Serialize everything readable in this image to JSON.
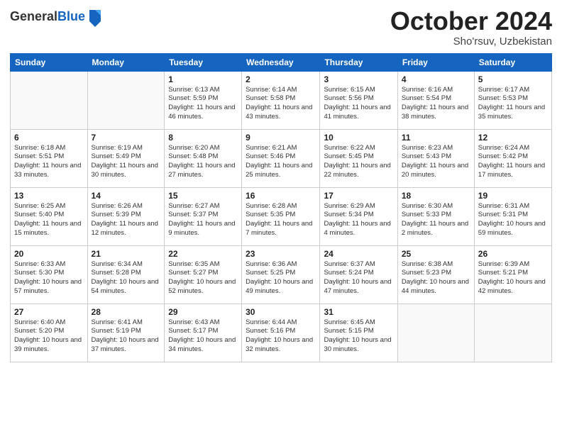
{
  "header": {
    "logo_general": "General",
    "logo_blue": "Blue",
    "month_title": "October 2024",
    "location": "Sho'rsuv, Uzbekistan"
  },
  "days_of_week": [
    "Sunday",
    "Monday",
    "Tuesday",
    "Wednesday",
    "Thursday",
    "Friday",
    "Saturday"
  ],
  "weeks": [
    [
      {
        "day": "",
        "sunrise": "",
        "sunset": "",
        "daylight": ""
      },
      {
        "day": "",
        "sunrise": "",
        "sunset": "",
        "daylight": ""
      },
      {
        "day": "1",
        "sunrise": "Sunrise: 6:13 AM",
        "sunset": "Sunset: 5:59 PM",
        "daylight": "Daylight: 11 hours and 46 minutes."
      },
      {
        "day": "2",
        "sunrise": "Sunrise: 6:14 AM",
        "sunset": "Sunset: 5:58 PM",
        "daylight": "Daylight: 11 hours and 43 minutes."
      },
      {
        "day": "3",
        "sunrise": "Sunrise: 6:15 AM",
        "sunset": "Sunset: 5:56 PM",
        "daylight": "Daylight: 11 hours and 41 minutes."
      },
      {
        "day": "4",
        "sunrise": "Sunrise: 6:16 AM",
        "sunset": "Sunset: 5:54 PM",
        "daylight": "Daylight: 11 hours and 38 minutes."
      },
      {
        "day": "5",
        "sunrise": "Sunrise: 6:17 AM",
        "sunset": "Sunset: 5:53 PM",
        "daylight": "Daylight: 11 hours and 35 minutes."
      }
    ],
    [
      {
        "day": "6",
        "sunrise": "Sunrise: 6:18 AM",
        "sunset": "Sunset: 5:51 PM",
        "daylight": "Daylight: 11 hours and 33 minutes."
      },
      {
        "day": "7",
        "sunrise": "Sunrise: 6:19 AM",
        "sunset": "Sunset: 5:49 PM",
        "daylight": "Daylight: 11 hours and 30 minutes."
      },
      {
        "day": "8",
        "sunrise": "Sunrise: 6:20 AM",
        "sunset": "Sunset: 5:48 PM",
        "daylight": "Daylight: 11 hours and 27 minutes."
      },
      {
        "day": "9",
        "sunrise": "Sunrise: 6:21 AM",
        "sunset": "Sunset: 5:46 PM",
        "daylight": "Daylight: 11 hours and 25 minutes."
      },
      {
        "day": "10",
        "sunrise": "Sunrise: 6:22 AM",
        "sunset": "Sunset: 5:45 PM",
        "daylight": "Daylight: 11 hours and 22 minutes."
      },
      {
        "day": "11",
        "sunrise": "Sunrise: 6:23 AM",
        "sunset": "Sunset: 5:43 PM",
        "daylight": "Daylight: 11 hours and 20 minutes."
      },
      {
        "day": "12",
        "sunrise": "Sunrise: 6:24 AM",
        "sunset": "Sunset: 5:42 PM",
        "daylight": "Daylight: 11 hours and 17 minutes."
      }
    ],
    [
      {
        "day": "13",
        "sunrise": "Sunrise: 6:25 AM",
        "sunset": "Sunset: 5:40 PM",
        "daylight": "Daylight: 11 hours and 15 minutes."
      },
      {
        "day": "14",
        "sunrise": "Sunrise: 6:26 AM",
        "sunset": "Sunset: 5:39 PM",
        "daylight": "Daylight: 11 hours and 12 minutes."
      },
      {
        "day": "15",
        "sunrise": "Sunrise: 6:27 AM",
        "sunset": "Sunset: 5:37 PM",
        "daylight": "Daylight: 11 hours and 9 minutes."
      },
      {
        "day": "16",
        "sunrise": "Sunrise: 6:28 AM",
        "sunset": "Sunset: 5:35 PM",
        "daylight": "Daylight: 11 hours and 7 minutes."
      },
      {
        "day": "17",
        "sunrise": "Sunrise: 6:29 AM",
        "sunset": "Sunset: 5:34 PM",
        "daylight": "Daylight: 11 hours and 4 minutes."
      },
      {
        "day": "18",
        "sunrise": "Sunrise: 6:30 AM",
        "sunset": "Sunset: 5:33 PM",
        "daylight": "Daylight: 11 hours and 2 minutes."
      },
      {
        "day": "19",
        "sunrise": "Sunrise: 6:31 AM",
        "sunset": "Sunset: 5:31 PM",
        "daylight": "Daylight: 10 hours and 59 minutes."
      }
    ],
    [
      {
        "day": "20",
        "sunrise": "Sunrise: 6:33 AM",
        "sunset": "Sunset: 5:30 PM",
        "daylight": "Daylight: 10 hours and 57 minutes."
      },
      {
        "day": "21",
        "sunrise": "Sunrise: 6:34 AM",
        "sunset": "Sunset: 5:28 PM",
        "daylight": "Daylight: 10 hours and 54 minutes."
      },
      {
        "day": "22",
        "sunrise": "Sunrise: 6:35 AM",
        "sunset": "Sunset: 5:27 PM",
        "daylight": "Daylight: 10 hours and 52 minutes."
      },
      {
        "day": "23",
        "sunrise": "Sunrise: 6:36 AM",
        "sunset": "Sunset: 5:25 PM",
        "daylight": "Daylight: 10 hours and 49 minutes."
      },
      {
        "day": "24",
        "sunrise": "Sunrise: 6:37 AM",
        "sunset": "Sunset: 5:24 PM",
        "daylight": "Daylight: 10 hours and 47 minutes."
      },
      {
        "day": "25",
        "sunrise": "Sunrise: 6:38 AM",
        "sunset": "Sunset: 5:23 PM",
        "daylight": "Daylight: 10 hours and 44 minutes."
      },
      {
        "day": "26",
        "sunrise": "Sunrise: 6:39 AM",
        "sunset": "Sunset: 5:21 PM",
        "daylight": "Daylight: 10 hours and 42 minutes."
      }
    ],
    [
      {
        "day": "27",
        "sunrise": "Sunrise: 6:40 AM",
        "sunset": "Sunset: 5:20 PM",
        "daylight": "Daylight: 10 hours and 39 minutes."
      },
      {
        "day": "28",
        "sunrise": "Sunrise: 6:41 AM",
        "sunset": "Sunset: 5:19 PM",
        "daylight": "Daylight: 10 hours and 37 minutes."
      },
      {
        "day": "29",
        "sunrise": "Sunrise: 6:43 AM",
        "sunset": "Sunset: 5:17 PM",
        "daylight": "Daylight: 10 hours and 34 minutes."
      },
      {
        "day": "30",
        "sunrise": "Sunrise: 6:44 AM",
        "sunset": "Sunset: 5:16 PM",
        "daylight": "Daylight: 10 hours and 32 minutes."
      },
      {
        "day": "31",
        "sunrise": "Sunrise: 6:45 AM",
        "sunset": "Sunset: 5:15 PM",
        "daylight": "Daylight: 10 hours and 30 minutes."
      },
      {
        "day": "",
        "sunrise": "",
        "sunset": "",
        "daylight": ""
      },
      {
        "day": "",
        "sunrise": "",
        "sunset": "",
        "daylight": ""
      }
    ]
  ]
}
